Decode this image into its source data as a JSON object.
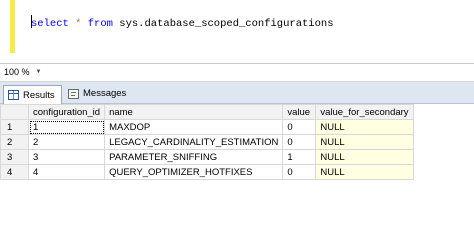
{
  "editor": {
    "keyword": "select",
    "star": "*",
    "from_keyword": "from",
    "object_name": "sys.database_scoped_configurations"
  },
  "status": {
    "zoom": "100 %"
  },
  "tabs": [
    {
      "label": "Results",
      "active": true
    },
    {
      "label": "Messages",
      "active": false
    }
  ],
  "grid": {
    "columns": [
      "configuration_id",
      "name",
      "value",
      "value_for_secondary"
    ],
    "rows": [
      {
        "num": "1",
        "configuration_id": "1",
        "name": "MAXDOP",
        "value": "0",
        "value_for_secondary": "NULL"
      },
      {
        "num": "2",
        "configuration_id": "2",
        "name": "LEGACY_CARDINALITY_ESTIMATION",
        "value": "0",
        "value_for_secondary": "NULL"
      },
      {
        "num": "3",
        "configuration_id": "3",
        "name": "PARAMETER_SNIFFING",
        "value": "1",
        "value_for_secondary": "NULL"
      },
      {
        "num": "4",
        "configuration_id": "4",
        "name": "QUERY_OPTIMIZER_HOTFIXES",
        "value": "0",
        "value_for_secondary": "NULL"
      }
    ]
  },
  "colors": {
    "gutter_marker": "#f7ec45",
    "keyword": "#0000ff",
    "null_cell_bg": "#ffffe1"
  }
}
